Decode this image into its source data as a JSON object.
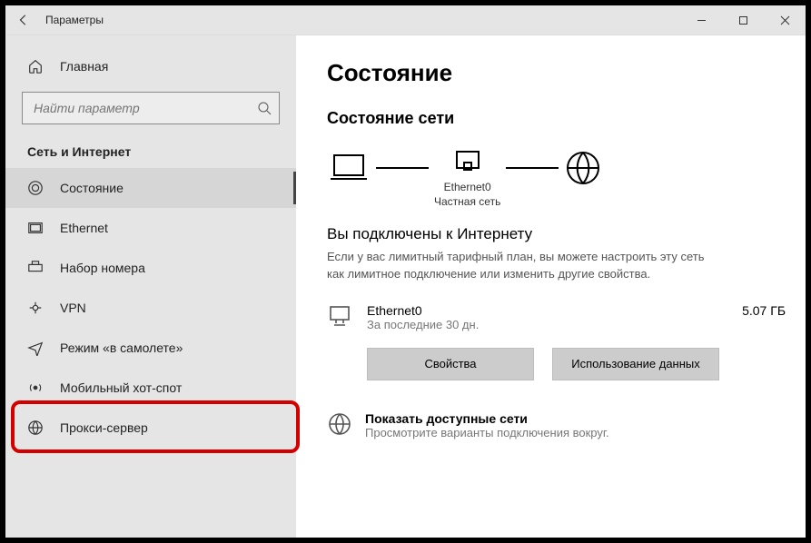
{
  "titlebar": {
    "title": "Параметры"
  },
  "sidebar": {
    "home": "Главная",
    "search_placeholder": "Найти параметр",
    "group": "Сеть и Интернет",
    "items": [
      {
        "label": "Состояние"
      },
      {
        "label": "Ethernet"
      },
      {
        "label": "Набор номера"
      },
      {
        "label": "VPN"
      },
      {
        "label": "Режим «в самолете»"
      },
      {
        "label": "Мобильный хот-спот"
      },
      {
        "label": "Прокси-сервер"
      }
    ]
  },
  "main": {
    "h1": "Состояние",
    "h2": "Состояние сети",
    "adapter_name": "Ethernet0",
    "adapter_profile": "Частная сеть",
    "connected_title": "Вы подключены к Интернету",
    "connected_desc": "Если у вас лимитный тарифный план, вы можете настроить эту сеть как лимитное подключение или изменить другие свойства.",
    "usage_name": "Ethernet0",
    "usage_period": "За последние 30 дн.",
    "usage_amount": "5.07 ГБ",
    "btn_props": "Свойства",
    "btn_usage": "Использование данных",
    "avail_title": "Показать доступные сети",
    "avail_sub": "Просмотрите варианты подключения вокруг."
  }
}
